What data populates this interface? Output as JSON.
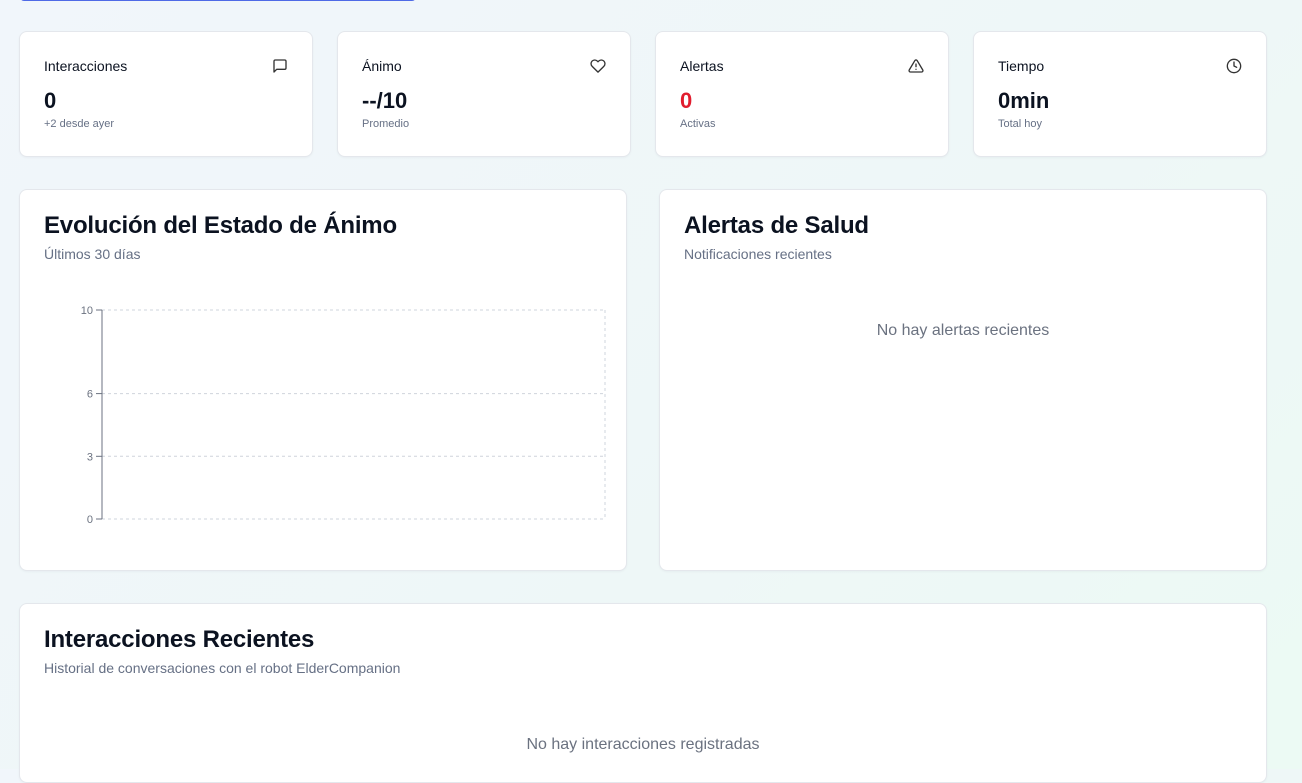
{
  "stats": [
    {
      "title": "Interacciones",
      "value": "0",
      "sub": "+2 desde ayer",
      "icon": "message-square-icon"
    },
    {
      "title": "Ánimo",
      "value": "--/10",
      "sub": "Promedio",
      "icon": "heart-icon"
    },
    {
      "title": "Alertas",
      "value": "0",
      "sub": "Activas",
      "icon": "alert-triangle-icon",
      "value_color": "#e11d2e"
    },
    {
      "title": "Tiempo",
      "value": "0min",
      "sub": "Total hoy",
      "icon": "clock-icon"
    }
  ],
  "mood_chart": {
    "title": "Evolución del Estado de Ánimo",
    "subtitle": "Últimos 30 días"
  },
  "chart_data": {
    "type": "line",
    "title": "Evolución del Estado de Ánimo",
    "subtitle": "Últimos 30 días",
    "x": [],
    "series": [],
    "ylim": [
      0,
      10
    ],
    "yticks": [
      0,
      3,
      6,
      10
    ],
    "grid": true
  },
  "alerts_panel": {
    "title": "Alertas de Salud",
    "subtitle": "Notificaciones recientes",
    "empty": "No hay alertas recientes"
  },
  "interactions_panel": {
    "title": "Interacciones Recientes",
    "subtitle": "Historial de conversaciones con el robot ElderCompanion",
    "empty": "No hay interacciones registradas"
  },
  "colors": {
    "accent": "#4f6ae6",
    "alert": "#e11d2e",
    "muted": "#667085"
  }
}
